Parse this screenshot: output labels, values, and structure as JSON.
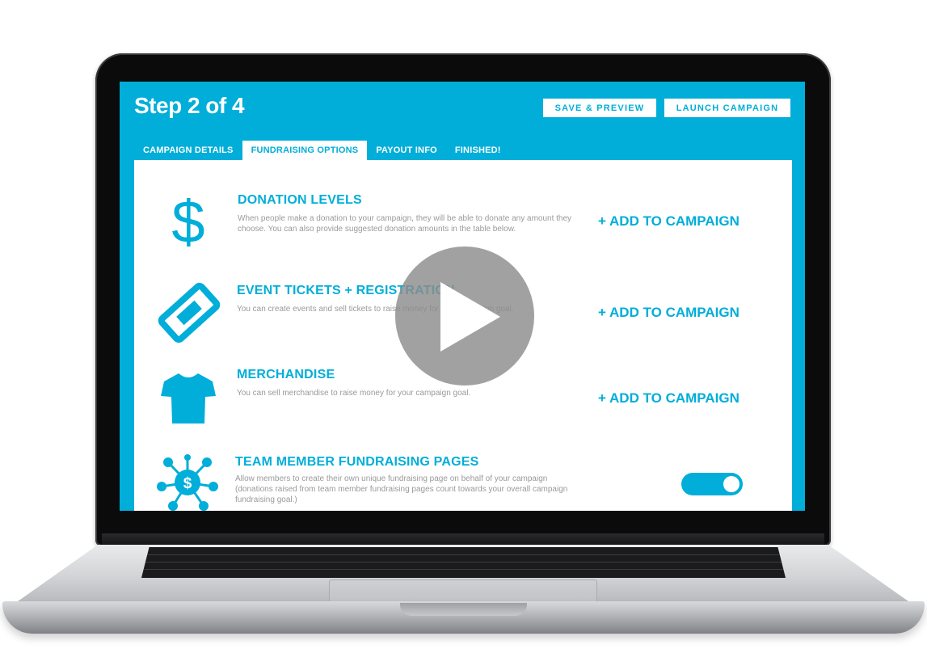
{
  "header": {
    "step_title": "Step 2 of 4",
    "save_preview_label": "SAVE & PREVIEW",
    "launch_label": "LAUNCH CAMPAIGN"
  },
  "tabs": [
    {
      "label": "CAMPAIGN DETAILS",
      "active": false
    },
    {
      "label": "FUNDRAISING OPTIONS",
      "active": true
    },
    {
      "label": "PAYOUT INFO",
      "active": false
    },
    {
      "label": "FINISHED!",
      "active": false
    }
  ],
  "options": [
    {
      "title": "DONATION LEVELS",
      "icon": "dollar-icon",
      "description": "When people make a donation to your campaign, they will be able to donate any amount they choose. You can also provide suggested donation amounts in the table below.",
      "action_label": "+ ADD TO CAMPAIGN"
    },
    {
      "title": "EVENT TICKETS + REGISTRATION",
      "icon": "ticket-icon",
      "description": "You can create events and sell tickets to raise money for your campaign goal.",
      "action_label": "+ ADD TO CAMPAIGN"
    },
    {
      "title": "MERCHANDISE",
      "icon": "tshirt-icon",
      "description": "You can sell merchandise to raise money for your campaign goal.",
      "action_label": "+ ADD TO CAMPAIGN"
    },
    {
      "title": "TEAM MEMBER FUNDRAISING PAGES",
      "icon": "team-network-icon",
      "description": "Allow members to create their own unique fundraising page on behalf of your campaign (donations raised from team member fundraising pages count towards your overall campaign fundraising goal.)",
      "toggle_on": true
    }
  ],
  "overlay": {
    "icon": "play-icon"
  },
  "colors": {
    "accent": "#00aed9",
    "text_muted": "#9a9a9a",
    "bezel": "#0b0b0c"
  }
}
